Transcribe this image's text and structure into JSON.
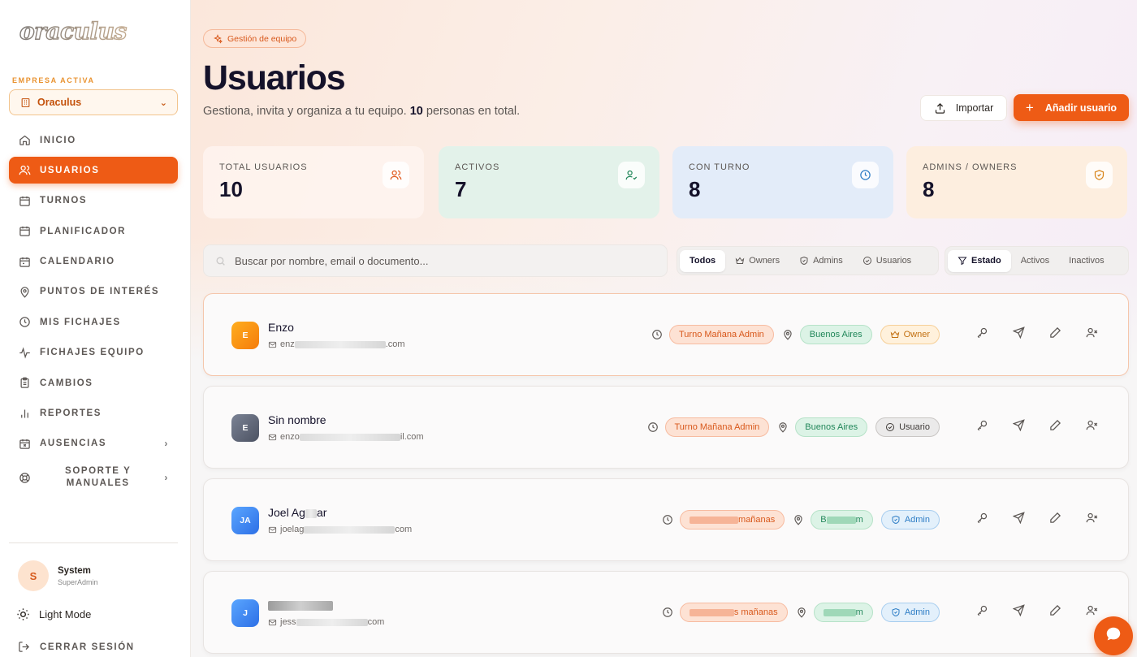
{
  "app": {
    "logo": "oraculus"
  },
  "sidebar": {
    "company_label": "EMPRESA ACTIVA",
    "company": "Oraculus",
    "items": [
      {
        "label": "INICIO",
        "icon": "home-icon"
      },
      {
        "label": "USUARIOS",
        "icon": "users-icon",
        "active": true
      },
      {
        "label": "TURNOS",
        "icon": "calendar-icon"
      },
      {
        "label": "PLANIFICADOR",
        "icon": "calendar-grid-icon"
      },
      {
        "label": "CALENDARIO",
        "icon": "calendar-icon"
      },
      {
        "label": "PUNTOS DE INTERÉS",
        "icon": "map-pin-icon"
      },
      {
        "label": "MIS FICHAJES",
        "icon": "clock-icon"
      },
      {
        "label": "FICHAJES EQUIPO",
        "icon": "activity-icon"
      },
      {
        "label": "CAMBIOS",
        "icon": "clipboard-icon"
      },
      {
        "label": "REPORTES",
        "icon": "bar-chart-icon"
      },
      {
        "label": "AUSENCIAS",
        "icon": "calendar-x-icon"
      },
      {
        "label": "SOPORTE Y MANUALES",
        "icon": "lifebuoy-icon"
      }
    ],
    "user": {
      "initial": "S",
      "name": "System",
      "role": "SuperAdmin"
    },
    "light_mode": "Light Mode",
    "logout": "CERRAR SESIÓN"
  },
  "header": {
    "tag": "Gestión de equipo",
    "title": "Usuarios",
    "subtitle_pre": "Gestiona, invita y organiza a tu equipo.",
    "subtitle_count": "10",
    "subtitle_post": "personas en total.",
    "import_label": "Importar",
    "add_label": "Añadir usuario"
  },
  "stats": [
    {
      "label": "TOTAL USUARIOS",
      "value": "10",
      "icon": "users-icon",
      "color": "#e0581c"
    },
    {
      "label": "ACTIVOS",
      "value": "7",
      "icon": "user-check-icon",
      "color": "#22875a"
    },
    {
      "label": "CON TURNO",
      "value": "8",
      "icon": "clock-icon",
      "color": "#2f7ec6"
    },
    {
      "label": "ADMINS / OWNERS",
      "value": "8",
      "icon": "shield-icon",
      "color": "#d8851b"
    }
  ],
  "search": {
    "placeholder": "Buscar por nombre, email o documento..."
  },
  "role_filters": [
    "Todos",
    "Owners",
    "Admins",
    "Usuarios"
  ],
  "status_filters": [
    "Estado",
    "Activos",
    "Inactivos"
  ],
  "users": [
    {
      "initial": "E",
      "name": "Enzo",
      "email_start": "enz",
      "email_end": ".com",
      "shift": "Turno Mañana Admin",
      "location": "Buenos Aires",
      "role": "Owner"
    },
    {
      "initial": "E",
      "name": "Sin nombre",
      "email_start": "enzo",
      "email_end": "il.com",
      "shift": "Turno Mañana Admin",
      "location": "Buenos Aires",
      "role": "Usuario"
    },
    {
      "initial": "JA",
      "name_start": "Joel Ag",
      "name_end": "ar",
      "email_start": "joelag",
      "email_end": "com",
      "shift_end": "mañanas",
      "location_start": "B",
      "location_end": "m",
      "role": "Admin"
    },
    {
      "initial": "J",
      "email_start": "jess",
      "email_end": "com",
      "shift_end": "s mañanas",
      "location_end": "m",
      "role": "Admin"
    }
  ]
}
